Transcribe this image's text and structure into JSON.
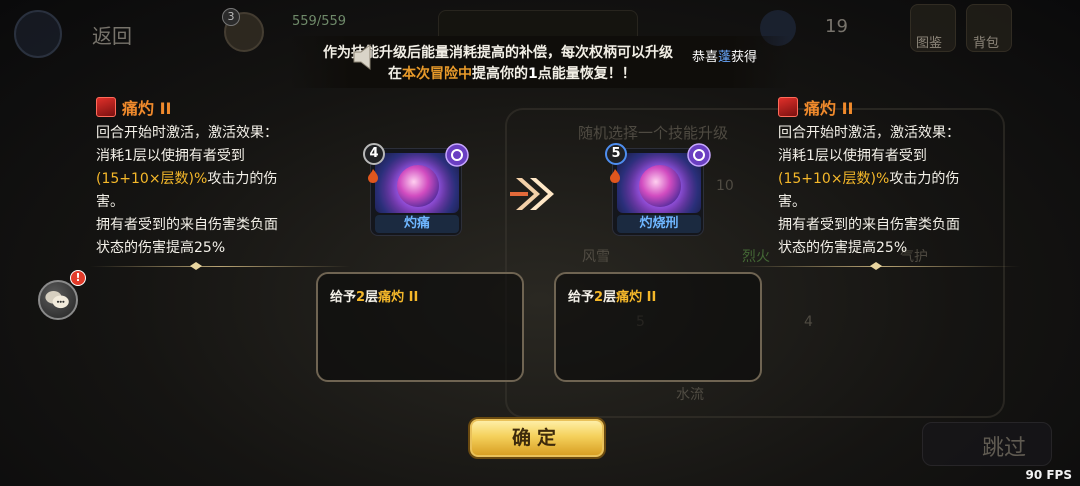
{
  "topbar": {
    "back_label": "返回",
    "avatar_level": "3",
    "hp": "559/559",
    "gem_count": "19",
    "atlas_label": "图鉴",
    "bag_label": "背包"
  },
  "banner": {
    "line1": "作为技能升级后能量消耗提高的补偿，每次权柄可以升级",
    "line2_prefix": "在",
    "line2_highlight": "本次冒险中",
    "line2_mid": "提高你的",
    "line2_num": "1",
    "line2_suffix": "点能量恢复！！",
    "toast_prefix": "恭喜",
    "toast_name": "蓬",
    "toast_suffix": "获得"
  },
  "background": {
    "hint": "随机选择一个技能升级",
    "ghost_cards": [
      "风雪",
      "烈火",
      "气护",
      "水流",
      "风雪"
    ],
    "ghost_levels": [
      "10",
      "5",
      "4"
    ]
  },
  "left_skill": {
    "name": "痛灼 II",
    "lines": [
      "回合开始时激活，激活效果：",
      "消耗1层以使拥有者受到"
    ],
    "formula": "(15+10×层数)%",
    "formula_suffix": "攻击力的伤",
    "line4": "害。",
    "line5": "拥有者受到的来自伤害类负面",
    "line6": "状态的伤害提高25%"
  },
  "right_skill": {
    "name": "痛灼 II",
    "lines": [
      "回合开始时激活，激活效果：",
      "消耗1层以使拥有者受到"
    ],
    "formula": "(15+10×层数)%",
    "formula_suffix": "攻击力的伤",
    "line4": "害。",
    "line5": "拥有者受到的来自伤害类负面",
    "line6": "状态的伤害提高25%"
  },
  "card_before": {
    "level": "4",
    "name": "灼痛"
  },
  "card_after": {
    "level": "5",
    "name": "灼烧刑"
  },
  "desc_before": {
    "prefix": "给予",
    "count": "2",
    "unit": "层",
    "skill": "痛灼 II"
  },
  "desc_after": {
    "prefix": "给予",
    "count": "2",
    "unit": "层",
    "skill": "痛灼 II"
  },
  "chat_badge": "!",
  "confirm_label": "确定",
  "skip_label": "跳过",
  "fps": "90 FPS",
  "colors": {
    "accent_gold": "#f5b82a",
    "skill_orange": "#f08a2c",
    "card_blue": "#6fb6ff",
    "button_gold": "#f5d15c"
  }
}
